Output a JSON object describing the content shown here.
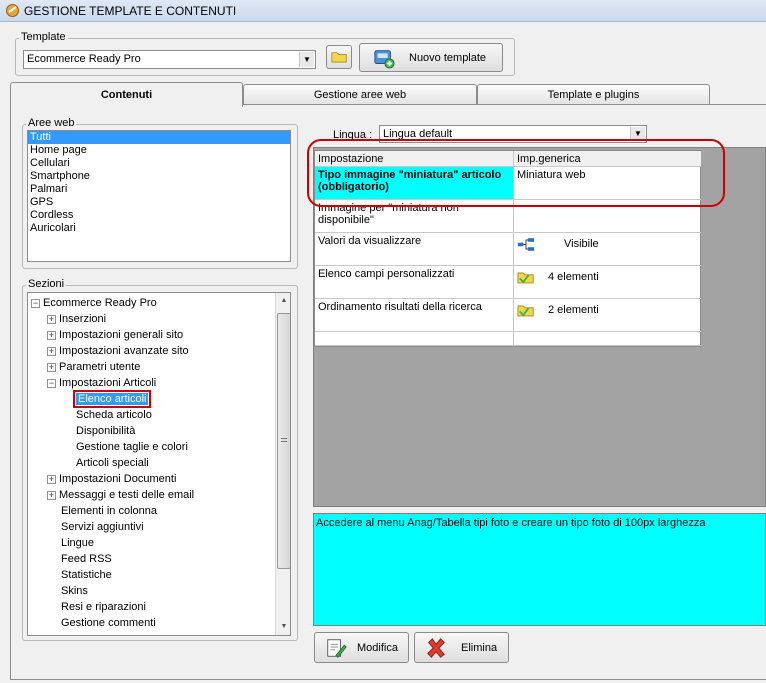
{
  "window": {
    "title": "GESTIONE TEMPLATE E CONTENUTI"
  },
  "template_group": {
    "legend": "Template",
    "selected": "Ecommerce Ready Pro",
    "new_button_label": "Nuovo template"
  },
  "tabs": [
    {
      "label": "Contenuti",
      "active": true
    },
    {
      "label": "Gestione aree web",
      "active": false
    },
    {
      "label": "Template e plugins",
      "active": false
    }
  ],
  "aree_web": {
    "legend": "Aree web",
    "items": [
      "Tutti",
      "Home page",
      "Cellulari",
      "Smartphone",
      "Palmari",
      "GPS",
      "Cordless",
      "Auricolari"
    ],
    "selected_index": 0
  },
  "sezioni": {
    "legend": "Sezioni",
    "root": "Ecommerce Ready Pro",
    "rows": [
      {
        "label": "Inserzioni",
        "expander": "+"
      },
      {
        "label": "Impostazioni generali sito",
        "expander": "+"
      },
      {
        "label": "Impostazioni avanzate sito",
        "expander": "+"
      },
      {
        "label": "Parametri utente",
        "expander": "+"
      },
      {
        "label": "Impostazioni Articoli",
        "expander": "-"
      },
      {
        "label": "Elenco articoli",
        "child": true,
        "selected": true
      },
      {
        "label": "Scheda articolo",
        "child": true
      },
      {
        "label": "Disponibilità",
        "child": true
      },
      {
        "label": "Gestione taglie e colori",
        "child": true
      },
      {
        "label": "Articoli speciali",
        "child": true
      },
      {
        "label": "Impostazioni Documenti",
        "expander": "+"
      },
      {
        "label": "Messaggi e testi delle email",
        "expander": "+"
      },
      {
        "label": "Elementi in colonna"
      },
      {
        "label": "Servizi aggiuntivi"
      },
      {
        "label": "Lingue"
      },
      {
        "label": "Feed RSS"
      },
      {
        "label": "Statistiche"
      },
      {
        "label": "Skins"
      },
      {
        "label": "Resi e riparazioni"
      },
      {
        "label": "Gestione commenti"
      }
    ]
  },
  "lingua": {
    "label": "Lingua :",
    "selected": "Lingua default"
  },
  "grid": {
    "headers": [
      "Impostazione",
      "Imp.generica"
    ],
    "rows": [
      {
        "setting": "Tipo immagine \"miniatura\" articolo (obbligatorio)",
        "value": "Miniatura web",
        "highlight": true
      },
      {
        "setting": "Immagine per \"miniatura non disponibile\"",
        "value": ""
      },
      {
        "setting": "Valori da visualizzare",
        "value": "Visibile",
        "icon": "tree-structure-icon"
      },
      {
        "setting": "Elenco campi personalizzati",
        "value": "4 elementi",
        "icon": "folder-icon"
      },
      {
        "setting": "Ordinamento risultati della ricerca",
        "value": "2 elementi",
        "icon": "folder-icon"
      }
    ]
  },
  "description": "Accedere al menu Anag/Tabella tipi foto e creare un tipo foto di 100px larghezza",
  "buttons": {
    "modifica": "Modifica",
    "elimina": "Elimina"
  },
  "colors": {
    "highlight": "#00ffff",
    "selection": "#3399ff",
    "annotation": "#cc0000",
    "grid_empty": "#a3a3a3"
  }
}
